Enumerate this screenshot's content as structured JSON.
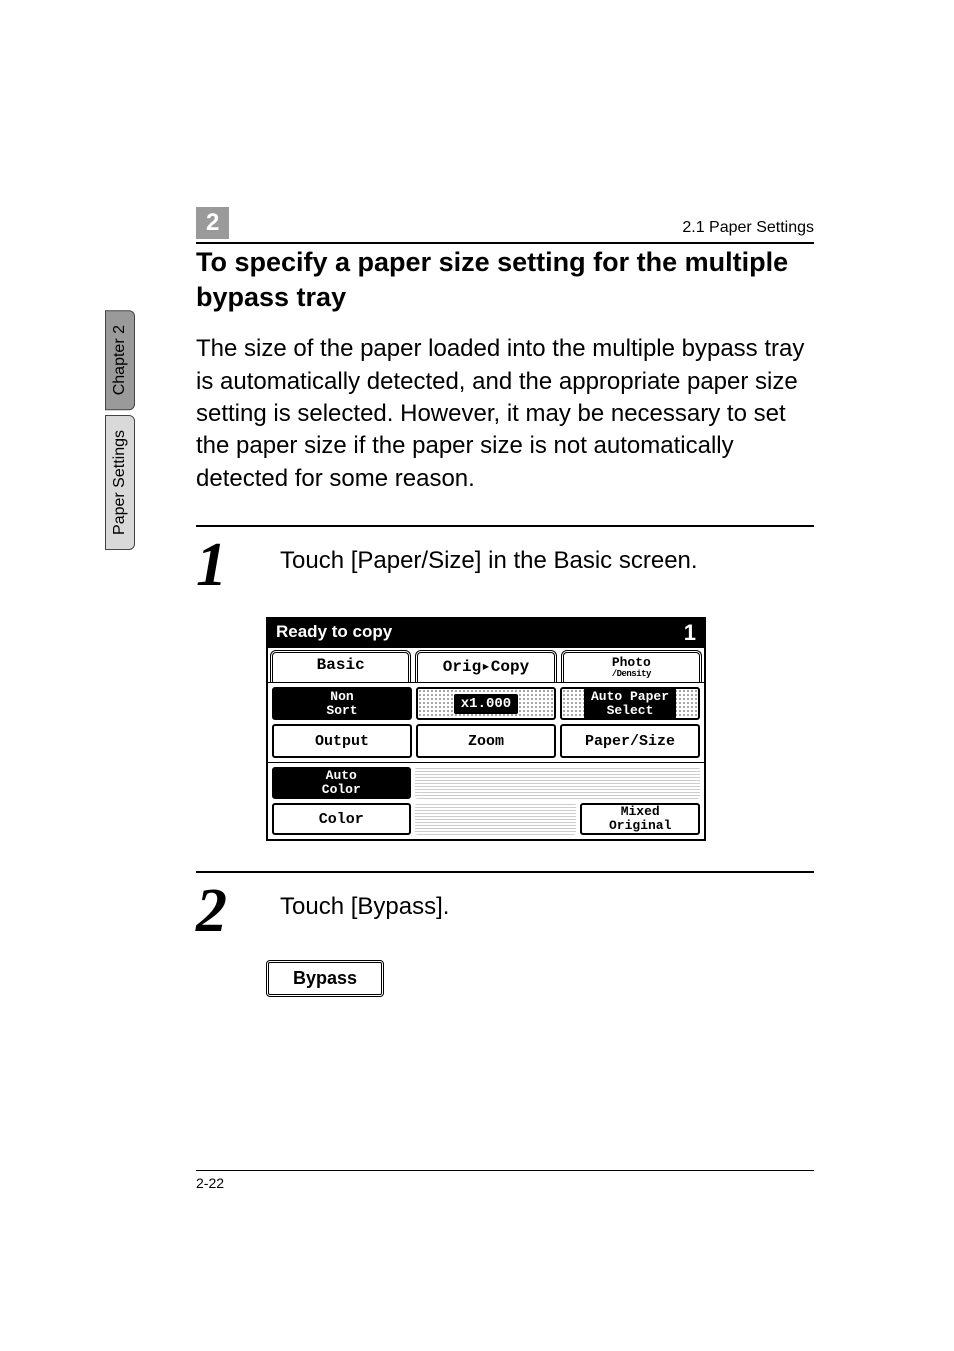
{
  "side_tabs": {
    "chapter": "Chapter 2",
    "section": "Paper Settings"
  },
  "header": {
    "chapter_num": "2",
    "title": "2.1 Paper Settings"
  },
  "heading": "To specify a paper size setting for the multiple bypass tray",
  "intro": "The size of the paper loaded into the multiple bypass tray is automatically detected, and the appropriate paper size setting is selected. However, it may be necessary to set the paper size if the paper size is not automatically detected for some reason.",
  "steps": [
    {
      "num": "1",
      "text": "Touch [Paper/Size] in the Basic screen."
    },
    {
      "num": "2",
      "text": "Touch [Bypass]."
    }
  ],
  "screen": {
    "status": "Ready to copy",
    "status_num": "1",
    "tabs": {
      "basic": "Basic",
      "origcopy": "Orig▸Copy",
      "photo": "Photo",
      "density": "/Density"
    },
    "row1": {
      "nonsort": "Non\nSort",
      "output": "Output",
      "zoom_val": "x1.000",
      "zoom": "Zoom",
      "auto_paper": "Auto Paper\nSelect",
      "paper_size": "Paper/Size"
    },
    "row2": {
      "auto_color": "Auto\nColor",
      "color": "Color",
      "mixed": "Mixed\nOriginal"
    }
  },
  "bypass_button": "Bypass",
  "page_num": "2-22"
}
